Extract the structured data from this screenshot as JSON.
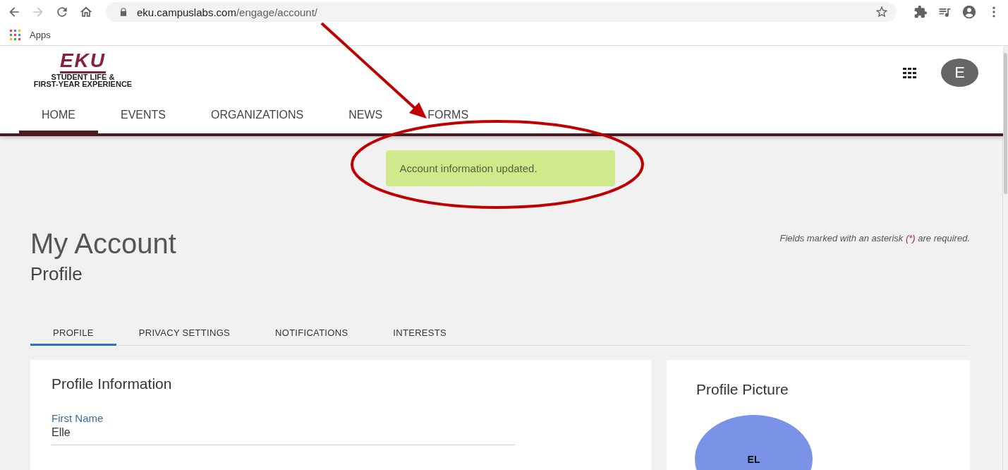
{
  "browser": {
    "url_host": "eku.campuslabs.com",
    "url_path": "/engage/account/",
    "bookmarks": [
      {
        "label": "Apps"
      }
    ]
  },
  "site": {
    "logo_text": "EKU",
    "logo_subtitle_1": "STUDENT LIFE &",
    "logo_subtitle_2": "FIRST-YEAR EXPERIENCE",
    "avatar_letter": "E",
    "nav": [
      {
        "label": "HOME",
        "selected": true
      },
      {
        "label": "EVENTS",
        "selected": false
      },
      {
        "label": "ORGANIZATIONS",
        "selected": false
      },
      {
        "label": "NEWS",
        "selected": false
      },
      {
        "label": "FORMS",
        "selected": false
      }
    ]
  },
  "toast": "Account information updated.",
  "required_note": {
    "before": "Fields marked with an asterisk",
    "mark": "(*)",
    "after": "are required."
  },
  "page_title": "My Account",
  "section_title": "Profile",
  "tabs": [
    {
      "label": "PROFILE",
      "selected": true
    },
    {
      "label": "PRIVACY SETTINGS",
      "selected": false
    },
    {
      "label": "NOTIFICATIONS",
      "selected": false
    },
    {
      "label": "INTERESTS",
      "selected": false
    }
  ],
  "profile_card": {
    "title": "Profile Information",
    "fields": [
      {
        "label": "First Name",
        "value": "Elle"
      }
    ]
  },
  "picture_card": {
    "title": "Profile Picture",
    "initials": "EL"
  }
}
